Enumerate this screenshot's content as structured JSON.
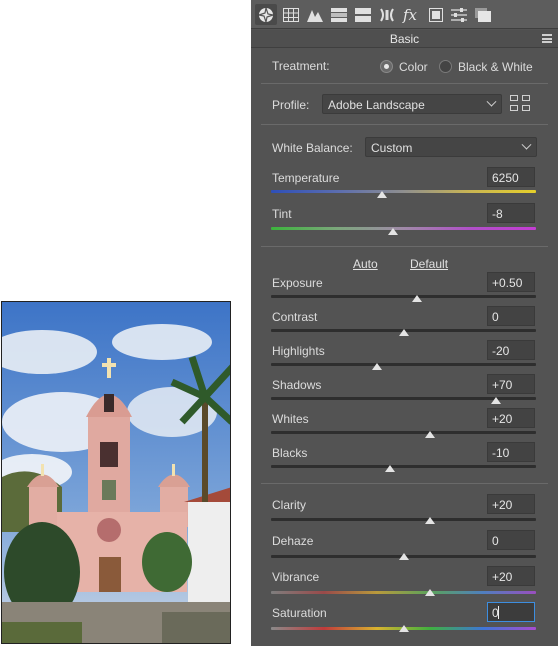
{
  "toolbar": {
    "tools": [
      {
        "icon": "aperture-icon",
        "active": true
      },
      {
        "icon": "tone-curve-icon"
      },
      {
        "icon": "detail-icon"
      },
      {
        "icon": "hsl-icon"
      },
      {
        "icon": "split-toning-icon"
      },
      {
        "icon": "lens-corrections-icon"
      },
      {
        "icon": "effects-fx-icon"
      },
      {
        "icon": "calibration-icon"
      },
      {
        "icon": "presets-sliders-icon"
      },
      {
        "icon": "snapshots-icon"
      }
    ]
  },
  "panel": {
    "section_title": "Basic",
    "treatment": {
      "label": "Treatment:",
      "options": [
        "Color",
        "Black & White"
      ],
      "selected": "Color"
    },
    "profile": {
      "label": "Profile:",
      "value": "Adobe Landscape"
    },
    "white_balance": {
      "label": "White Balance:",
      "value": "Custom"
    },
    "auto_label": "Auto",
    "default_label": "Default"
  },
  "sliders": [
    {
      "label": "Temperature",
      "value": "6250",
      "position": 0.42,
      "track": "temp"
    },
    {
      "label": "Tint",
      "value": "-8",
      "position": 0.46,
      "track": "tint"
    },
    {
      "label": "Exposure",
      "value": "+0.50",
      "position": 0.55,
      "track": "gray"
    },
    {
      "label": "Contrast",
      "value": "0",
      "position": 0.5,
      "track": "gray"
    },
    {
      "label": "Highlights",
      "value": "-20",
      "position": 0.4,
      "track": "gray"
    },
    {
      "label": "Shadows",
      "value": "+70",
      "position": 0.85,
      "track": "gray"
    },
    {
      "label": "Whites",
      "value": "+20",
      "position": 0.6,
      "track": "gray"
    },
    {
      "label": "Blacks",
      "value": "-10",
      "position": 0.45,
      "track": "gray"
    },
    {
      "label": "Clarity",
      "value": "+20",
      "position": 0.6,
      "track": "gray"
    },
    {
      "label": "Dehaze",
      "value": "0",
      "position": 0.5,
      "track": "gray"
    },
    {
      "label": "Vibrance",
      "value": "+20",
      "position": 0.6,
      "track": "vib"
    },
    {
      "label": "Saturation",
      "value": "0",
      "position": 0.5,
      "track": "sat",
      "focused": true
    }
  ],
  "colors": {
    "panel_bg": "#535353",
    "focus_border": "#3d8ee0"
  }
}
